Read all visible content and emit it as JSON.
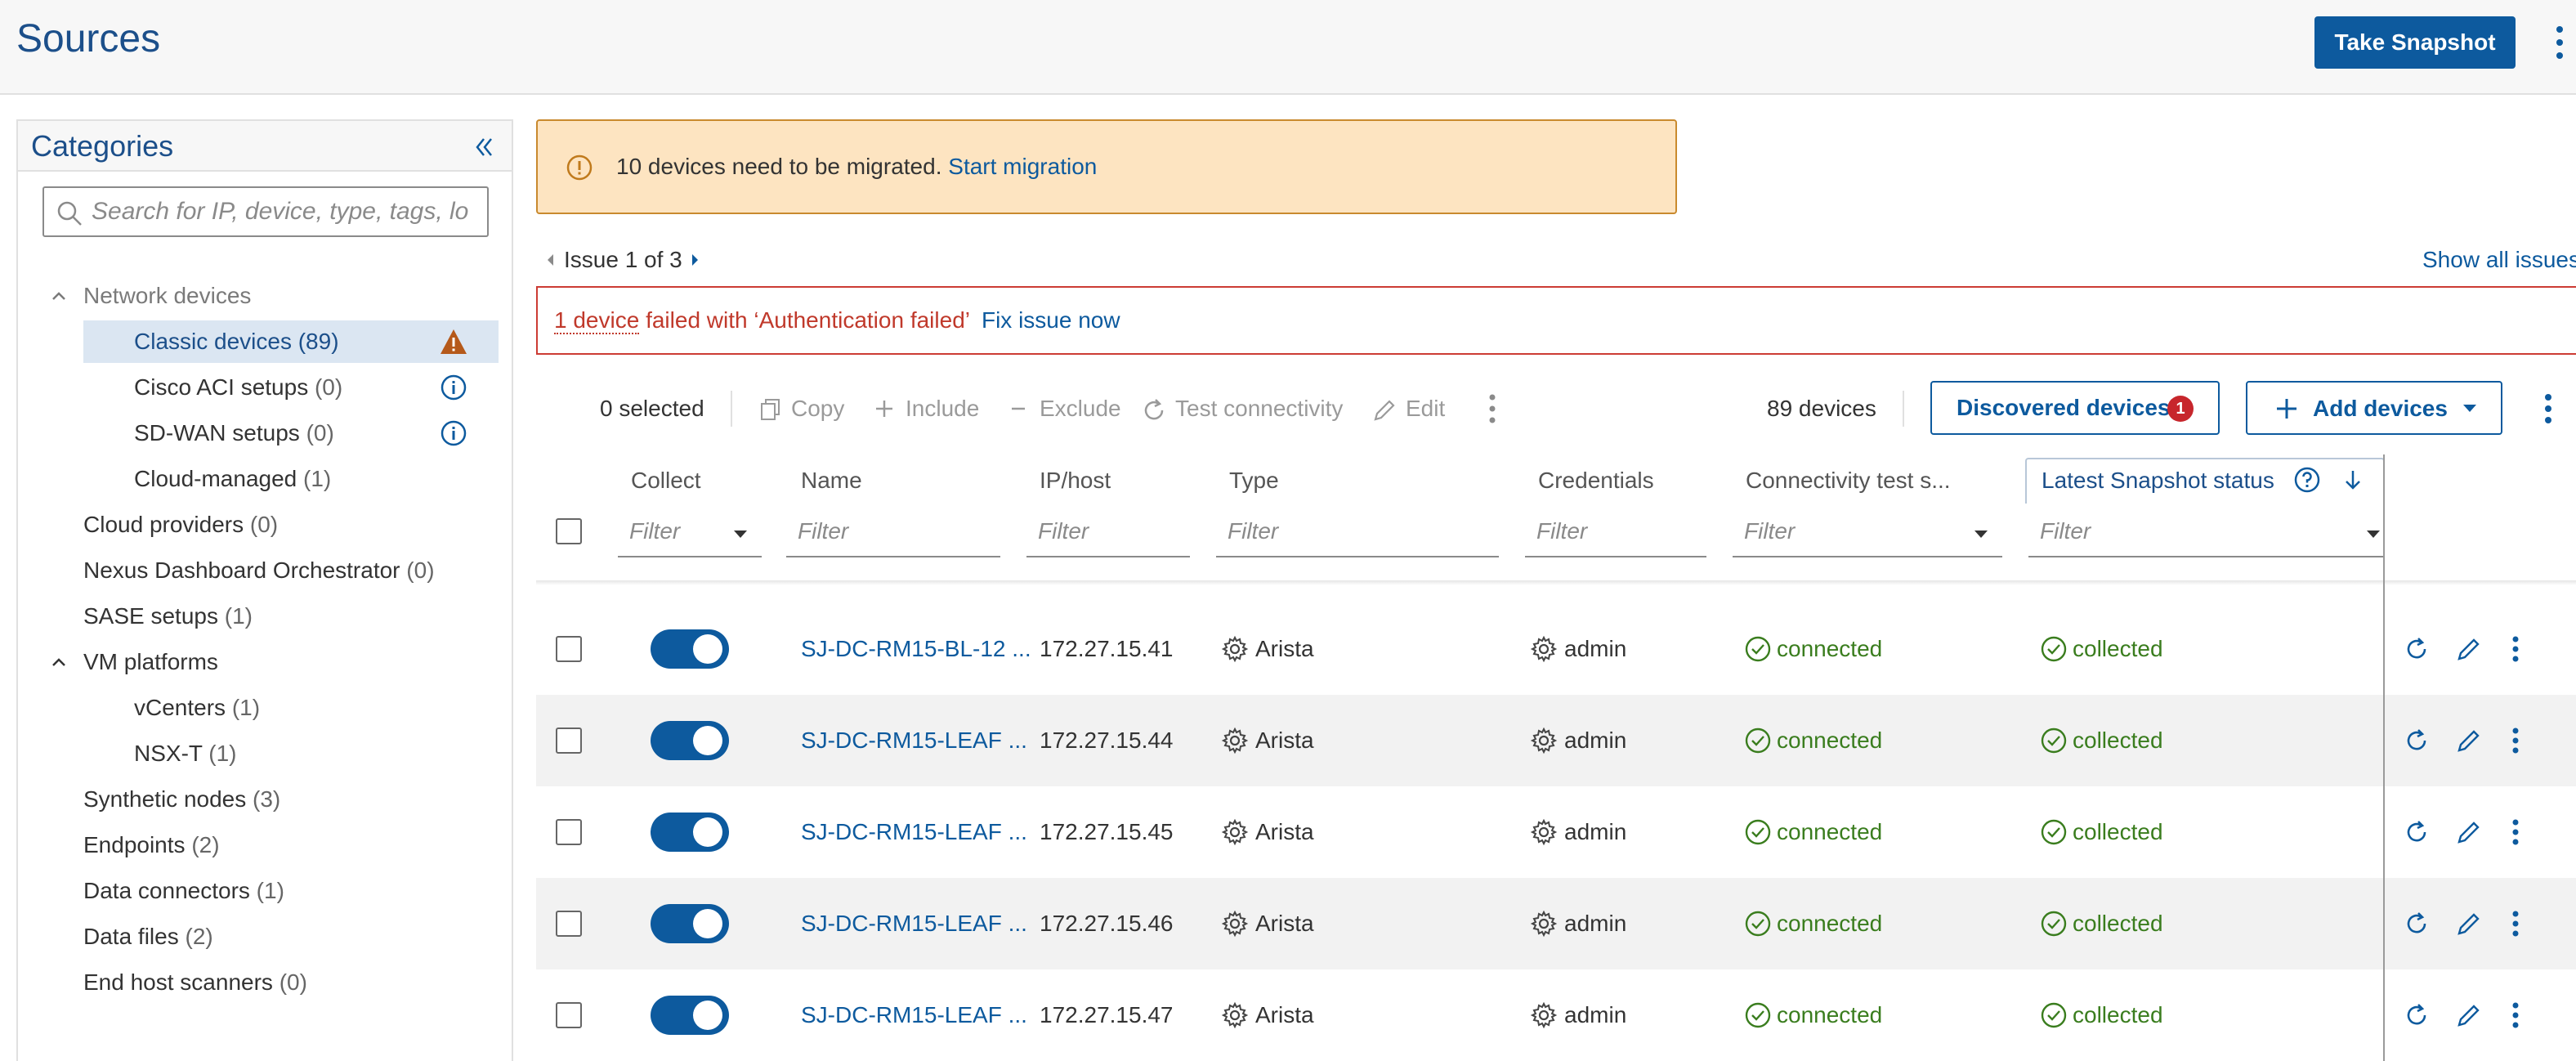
{
  "header": {
    "title": "Sources",
    "snapshot_label": "Take Snapshot"
  },
  "sidebar": {
    "title": "Categories",
    "search_placeholder": "Search for IP, device, type, tags, lo",
    "items": [
      {
        "label": "Network devices",
        "count": ""
      },
      {
        "label": "Classic devices",
        "count": "(89)"
      },
      {
        "label": "Cisco ACI setups",
        "count": "(0)"
      },
      {
        "label": "SD-WAN setups",
        "count": "(0)"
      },
      {
        "label": "Cloud-managed",
        "count": "(1)"
      },
      {
        "label": "Cloud providers",
        "count": "(0)"
      },
      {
        "label": "Nexus Dashboard Orchestrator",
        "count": "(0)"
      },
      {
        "label": "SASE setups",
        "count": "(1)"
      },
      {
        "label": "VM platforms",
        "count": ""
      },
      {
        "label": "vCenters",
        "count": "(1)"
      },
      {
        "label": "NSX-T",
        "count": "(1)"
      },
      {
        "label": "Synthetic nodes",
        "count": "(3)"
      },
      {
        "label": "Endpoints",
        "count": "(2)"
      },
      {
        "label": "Data connectors",
        "count": "(1)"
      },
      {
        "label": "Data files",
        "count": "(2)"
      },
      {
        "label": "End host scanners",
        "count": "(0)"
      }
    ]
  },
  "migration": {
    "message": "10 devices need to be migrated.",
    "link": "Start migration"
  },
  "issues": {
    "label": "Issue 1 of 3",
    "show_all": "Show all issues"
  },
  "error": {
    "device_link": "1 device",
    "message": " failed with ‘Authentication failed’",
    "fix_link": "Fix issue now"
  },
  "toolbar": {
    "selected": "0 selected",
    "copy": "Copy",
    "include": "Include",
    "exclude": "Exclude",
    "test": "Test connectivity",
    "edit": "Edit",
    "device_count": "89 devices",
    "discovered": "Discovered devices",
    "discovered_badge": "1",
    "add": "Add devices"
  },
  "table": {
    "columns": {
      "collect": "Collect",
      "name": "Name",
      "ip": "IP/host",
      "type": "Type",
      "credentials": "Credentials",
      "connectivity": "Connectivity test s...",
      "snapshot": "Latest Snapshot status"
    },
    "filter_placeholder": "Filter",
    "rows": [
      {
        "name": "SJ-DC-RM15-BL-12 ...",
        "ip": "172.27.15.41",
        "type": "Arista",
        "credentials": "admin",
        "connectivity": "connected",
        "snapshot": "collected"
      },
      {
        "name": "SJ-DC-RM15-LEAF ...",
        "ip": "172.27.15.44",
        "type": "Arista",
        "credentials": "admin",
        "connectivity": "connected",
        "snapshot": "collected"
      },
      {
        "name": "SJ-DC-RM15-LEAF ...",
        "ip": "172.27.15.45",
        "type": "Arista",
        "credentials": "admin",
        "connectivity": "connected",
        "snapshot": "collected"
      },
      {
        "name": "SJ-DC-RM15-LEAF ...",
        "ip": "172.27.15.46",
        "type": "Arista",
        "credentials": "admin",
        "connectivity": "connected",
        "snapshot": "collected"
      },
      {
        "name": "SJ-DC-RM15-LEAF ...",
        "ip": "172.27.15.47",
        "type": "Arista",
        "credentials": "admin",
        "connectivity": "connected",
        "snapshot": "collected"
      }
    ]
  },
  "colors": {
    "accent": "#0d5a9e",
    "title": "#1c4f8a",
    "warning": "#c98a2e",
    "error": "#c0392b",
    "success": "#3a7d1e"
  }
}
